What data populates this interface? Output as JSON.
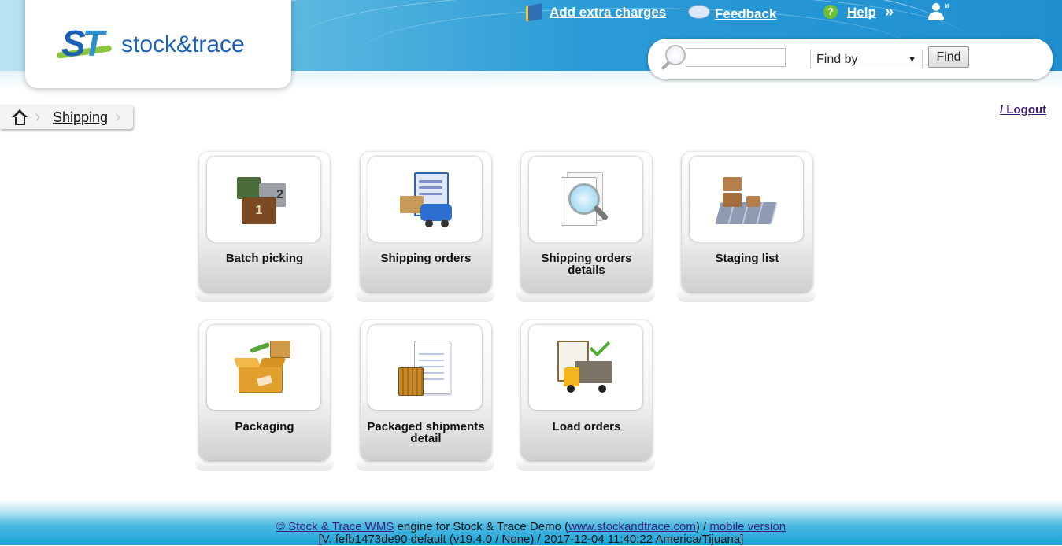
{
  "header": {
    "logo_text": "stock&trace",
    "logo_mark": "ST",
    "links": {
      "add_extra_charges": "Add extra charges",
      "feedback": "Feedback",
      "help": "Help",
      "more": "»",
      "user_more": "»"
    },
    "search": {
      "input_value": "",
      "find_by_label": "Find by",
      "find_button": "Find"
    }
  },
  "breadcrumb": {
    "current": "Shipping"
  },
  "logout": "/ Logout",
  "tiles": [
    {
      "label": "Batch picking",
      "icon": "boxes-icon"
    },
    {
      "label": "Shipping orders",
      "icon": "clipboard-cart-icon"
    },
    {
      "label": "Shipping orders details",
      "icon": "document-magnifier-icon"
    },
    {
      "label": "Staging list",
      "icon": "pallet-grid-icon"
    },
    {
      "label": "Packaging",
      "icon": "open-box-icon"
    },
    {
      "label": "Packaged shipments detail",
      "icon": "crate-document-icon"
    },
    {
      "label": "Load orders",
      "icon": "truck-checklist-icon"
    }
  ],
  "footer": {
    "copyright_link": "© Stock & Trace WMS",
    "engine_text": " engine for Stock & Trace Demo (",
    "site_link": "www.stockandtrace.com",
    "sep_text": ") / ",
    "mobile_link": "mobile version",
    "version_line": "[V. fefb1473de90 default (v19.4.0 / None) / 2017-12-04 11:40:22 America/Tijuana]"
  },
  "colors": {
    "header_blue": "#1f8fd0",
    "link_purple": "#3f1d78",
    "logo_blue": "#1a5fb4",
    "logo_green": "#8cc63f"
  }
}
